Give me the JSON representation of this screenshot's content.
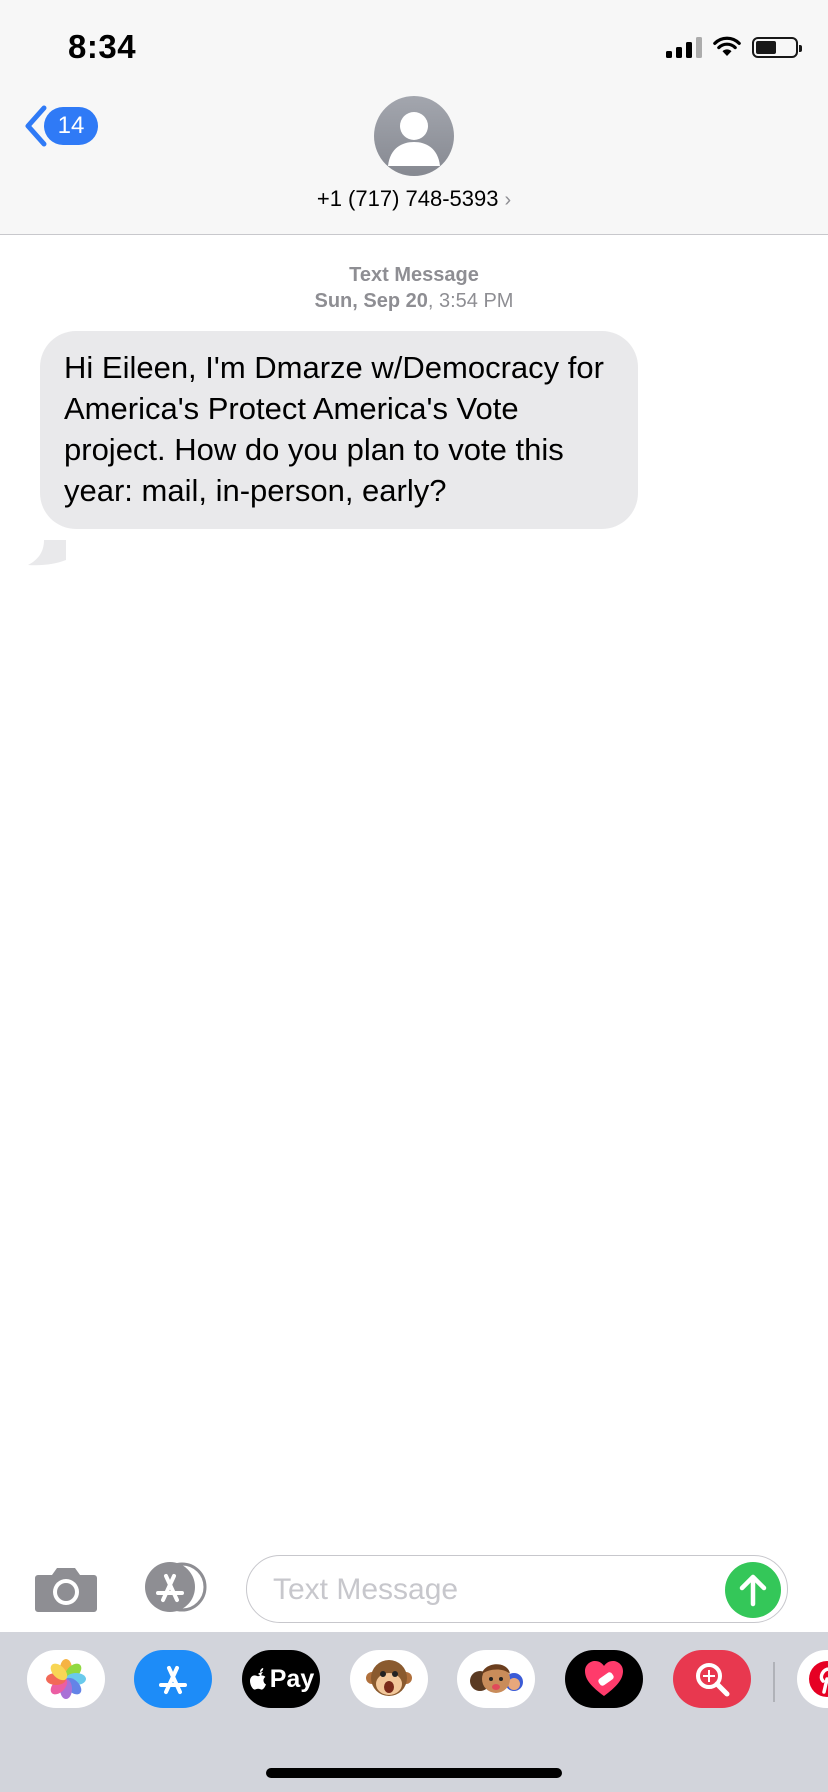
{
  "status_bar": {
    "time": "8:34"
  },
  "nav": {
    "back_count": "14",
    "contact_number": "+1 (717) 748-5393",
    "contact_chevron": "›"
  },
  "thread": {
    "service_label": "Text Message",
    "date_bold": "Sun, Sep 20",
    "time_suffix": ", 3:54 PM",
    "messages": [
      {
        "direction": "incoming",
        "text": "Hi Eileen, I'm Dmarze w/Democracy for America's Protect America's Vote project. How do you plan to vote this year: mail, in-person, early?"
      }
    ]
  },
  "composer": {
    "placeholder": "Text Message"
  },
  "app_drawer": {
    "apple_pay_label": "Pay",
    "apps": [
      "photos-icon",
      "app-store-icon",
      "apple-pay-icon",
      "animoji-icon",
      "memoji-icon",
      "heart-sticker-icon",
      "image-search-icon",
      "pinterest-icon"
    ]
  },
  "colors": {
    "accent": "#2f7af6",
    "send": "#34c759",
    "bubble_incoming": "#e9e9eb"
  }
}
